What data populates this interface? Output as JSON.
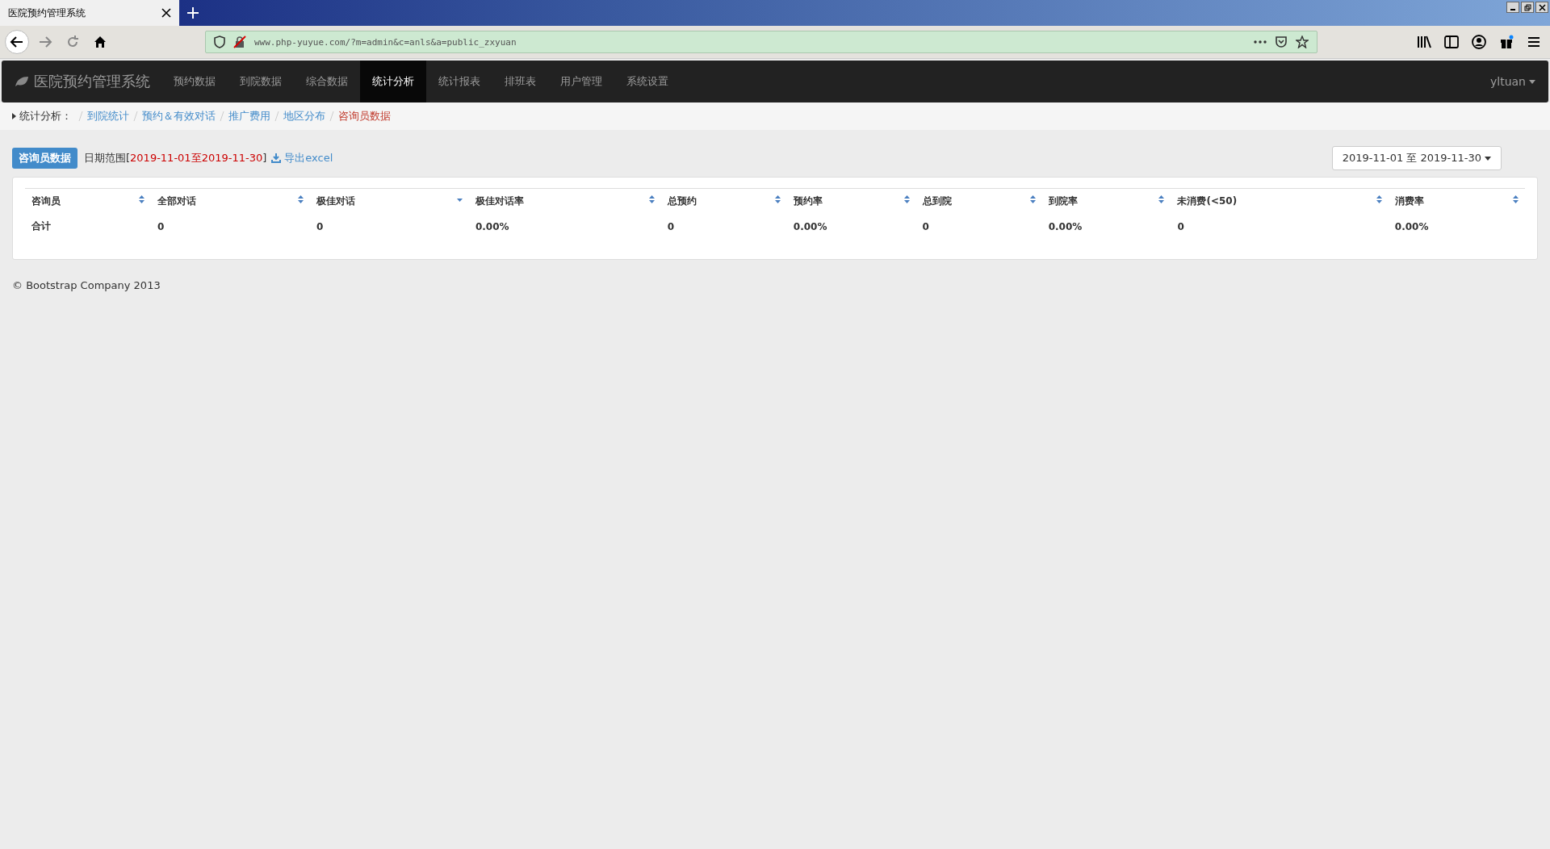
{
  "browser": {
    "tab_title": "医院预约管理系统",
    "url": "www.php-yuyue.com/?m=admin&c=anls&a=public_zxyuan"
  },
  "navbar": {
    "brand": "医院预约管理系统",
    "items": [
      {
        "label": "预约数据",
        "selected": false
      },
      {
        "label": "到院数据",
        "selected": false
      },
      {
        "label": "综合数据",
        "selected": false
      },
      {
        "label": "统计分析",
        "selected": true
      },
      {
        "label": "统计报表",
        "selected": false
      },
      {
        "label": "排班表",
        "selected": false
      },
      {
        "label": "用户管理",
        "selected": false
      },
      {
        "label": "系统设置",
        "selected": false
      }
    ],
    "user": "yltuan"
  },
  "breadcrumb": {
    "label": "统计分析：",
    "items": [
      {
        "label": "到院统计",
        "selected": false
      },
      {
        "label": "预约＆有效对话",
        "selected": false
      },
      {
        "label": "推广费用",
        "selected": false
      },
      {
        "label": "地区分布",
        "selected": false
      },
      {
        "label": "咨询员数据",
        "selected": true
      }
    ]
  },
  "header": {
    "badge": "咨询员数据",
    "range_label": "日期范围[",
    "range_value": "2019-11-01至2019-11-30",
    "range_end": "]",
    "export": "导出excel",
    "date_picker": "2019-11-01 至 2019-11-30"
  },
  "table": {
    "columns": [
      {
        "label": "咨询员",
        "sorted": false
      },
      {
        "label": "全部对话",
        "sorted": false
      },
      {
        "label": "极佳对话",
        "sorted": true
      },
      {
        "label": "极佳对话率",
        "sorted": false
      },
      {
        "label": "总预约",
        "sorted": false
      },
      {
        "label": "预约率",
        "sorted": false
      },
      {
        "label": "总到院",
        "sorted": false
      },
      {
        "label": "到院率",
        "sorted": false
      },
      {
        "label": "未消费(<50)",
        "sorted": false
      },
      {
        "label": "消费率",
        "sorted": false
      }
    ],
    "rows": [
      [
        "合计",
        "0",
        "0",
        "0.00%",
        "0",
        "0.00%",
        "0",
        "0.00%",
        "0",
        "0.00%"
      ]
    ]
  },
  "footer": "© Bootstrap Company 2013"
}
